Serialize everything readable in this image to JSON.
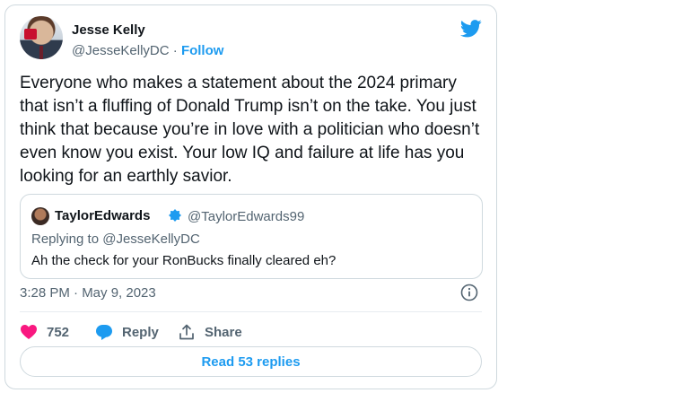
{
  "author": {
    "name": "Jesse Kelly",
    "handle": "@JesseKellyDC",
    "separator": "·",
    "follow_label": "Follow"
  },
  "tweet": {
    "text": "Everyone who makes a statement about the 2024 primary that isn’t a fluffing of Donald Trump isn’t on the take. You just think that because you’re in love with a politician who doesn’t even know you exist. Your low IQ and failure at life has you looking for an earthly savior.",
    "timestamp": "3:28 PM · May 9, 2023"
  },
  "quoted_tweet": {
    "name": "TaylorEdwards",
    "handle": "@TaylorEdwards99",
    "replying_to": "Replying to @JesseKellyDC",
    "text": "Ah the check for your RonBucks finally cleared eh?"
  },
  "actions": {
    "like_count": "752",
    "reply_label": "Reply",
    "share_label": "Share"
  },
  "read_replies_label": "Read 53 replies",
  "colors": {
    "accent": "#1d9bf0",
    "like": "#f91880",
    "text": "#0f1419",
    "muted": "#536471",
    "border": "#cfd9de"
  },
  "icons": [
    "twitter-bird-icon",
    "verified-badge-icon",
    "info-icon",
    "heart-icon",
    "reply-bubble-icon",
    "share-icon"
  ]
}
